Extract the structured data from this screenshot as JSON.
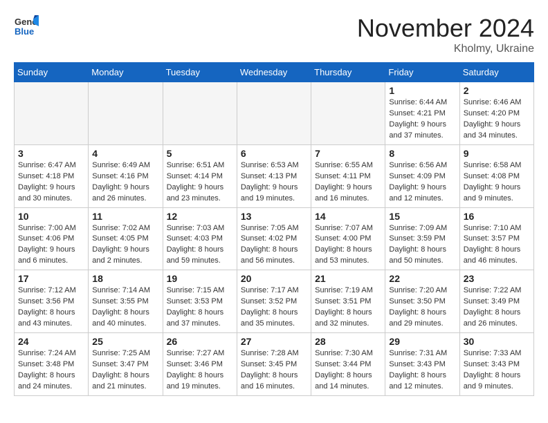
{
  "header": {
    "logo_line1": "General",
    "logo_line2": "Blue",
    "month_title": "November 2024",
    "location": "Kholmy, Ukraine"
  },
  "weekdays": [
    "Sunday",
    "Monday",
    "Tuesday",
    "Wednesday",
    "Thursday",
    "Friday",
    "Saturday"
  ],
  "weeks": [
    [
      {
        "day": "",
        "info": ""
      },
      {
        "day": "",
        "info": ""
      },
      {
        "day": "",
        "info": ""
      },
      {
        "day": "",
        "info": ""
      },
      {
        "day": "",
        "info": ""
      },
      {
        "day": "1",
        "info": "Sunrise: 6:44 AM\nSunset: 4:21 PM\nDaylight: 9 hours\nand 37 minutes."
      },
      {
        "day": "2",
        "info": "Sunrise: 6:46 AM\nSunset: 4:20 PM\nDaylight: 9 hours\nand 34 minutes."
      }
    ],
    [
      {
        "day": "3",
        "info": "Sunrise: 6:47 AM\nSunset: 4:18 PM\nDaylight: 9 hours\nand 30 minutes."
      },
      {
        "day": "4",
        "info": "Sunrise: 6:49 AM\nSunset: 4:16 PM\nDaylight: 9 hours\nand 26 minutes."
      },
      {
        "day": "5",
        "info": "Sunrise: 6:51 AM\nSunset: 4:14 PM\nDaylight: 9 hours\nand 23 minutes."
      },
      {
        "day": "6",
        "info": "Sunrise: 6:53 AM\nSunset: 4:13 PM\nDaylight: 9 hours\nand 19 minutes."
      },
      {
        "day": "7",
        "info": "Sunrise: 6:55 AM\nSunset: 4:11 PM\nDaylight: 9 hours\nand 16 minutes."
      },
      {
        "day": "8",
        "info": "Sunrise: 6:56 AM\nSunset: 4:09 PM\nDaylight: 9 hours\nand 12 minutes."
      },
      {
        "day": "9",
        "info": "Sunrise: 6:58 AM\nSunset: 4:08 PM\nDaylight: 9 hours\nand 9 minutes."
      }
    ],
    [
      {
        "day": "10",
        "info": "Sunrise: 7:00 AM\nSunset: 4:06 PM\nDaylight: 9 hours\nand 6 minutes."
      },
      {
        "day": "11",
        "info": "Sunrise: 7:02 AM\nSunset: 4:05 PM\nDaylight: 9 hours\nand 2 minutes."
      },
      {
        "day": "12",
        "info": "Sunrise: 7:03 AM\nSunset: 4:03 PM\nDaylight: 8 hours\nand 59 minutes."
      },
      {
        "day": "13",
        "info": "Sunrise: 7:05 AM\nSunset: 4:02 PM\nDaylight: 8 hours\nand 56 minutes."
      },
      {
        "day": "14",
        "info": "Sunrise: 7:07 AM\nSunset: 4:00 PM\nDaylight: 8 hours\nand 53 minutes."
      },
      {
        "day": "15",
        "info": "Sunrise: 7:09 AM\nSunset: 3:59 PM\nDaylight: 8 hours\nand 50 minutes."
      },
      {
        "day": "16",
        "info": "Sunrise: 7:10 AM\nSunset: 3:57 PM\nDaylight: 8 hours\nand 46 minutes."
      }
    ],
    [
      {
        "day": "17",
        "info": "Sunrise: 7:12 AM\nSunset: 3:56 PM\nDaylight: 8 hours\nand 43 minutes."
      },
      {
        "day": "18",
        "info": "Sunrise: 7:14 AM\nSunset: 3:55 PM\nDaylight: 8 hours\nand 40 minutes."
      },
      {
        "day": "19",
        "info": "Sunrise: 7:15 AM\nSunset: 3:53 PM\nDaylight: 8 hours\nand 37 minutes."
      },
      {
        "day": "20",
        "info": "Sunrise: 7:17 AM\nSunset: 3:52 PM\nDaylight: 8 hours\nand 35 minutes."
      },
      {
        "day": "21",
        "info": "Sunrise: 7:19 AM\nSunset: 3:51 PM\nDaylight: 8 hours\nand 32 minutes."
      },
      {
        "day": "22",
        "info": "Sunrise: 7:20 AM\nSunset: 3:50 PM\nDaylight: 8 hours\nand 29 minutes."
      },
      {
        "day": "23",
        "info": "Sunrise: 7:22 AM\nSunset: 3:49 PM\nDaylight: 8 hours\nand 26 minutes."
      }
    ],
    [
      {
        "day": "24",
        "info": "Sunrise: 7:24 AM\nSunset: 3:48 PM\nDaylight: 8 hours\nand 24 minutes."
      },
      {
        "day": "25",
        "info": "Sunrise: 7:25 AM\nSunset: 3:47 PM\nDaylight: 8 hours\nand 21 minutes."
      },
      {
        "day": "26",
        "info": "Sunrise: 7:27 AM\nSunset: 3:46 PM\nDaylight: 8 hours\nand 19 minutes."
      },
      {
        "day": "27",
        "info": "Sunrise: 7:28 AM\nSunset: 3:45 PM\nDaylight: 8 hours\nand 16 minutes."
      },
      {
        "day": "28",
        "info": "Sunrise: 7:30 AM\nSunset: 3:44 PM\nDaylight: 8 hours\nand 14 minutes."
      },
      {
        "day": "29",
        "info": "Sunrise: 7:31 AM\nSunset: 3:43 PM\nDaylight: 8 hours\nand 12 minutes."
      },
      {
        "day": "30",
        "info": "Sunrise: 7:33 AM\nSunset: 3:43 PM\nDaylight: 8 hours\nand 9 minutes."
      }
    ]
  ]
}
